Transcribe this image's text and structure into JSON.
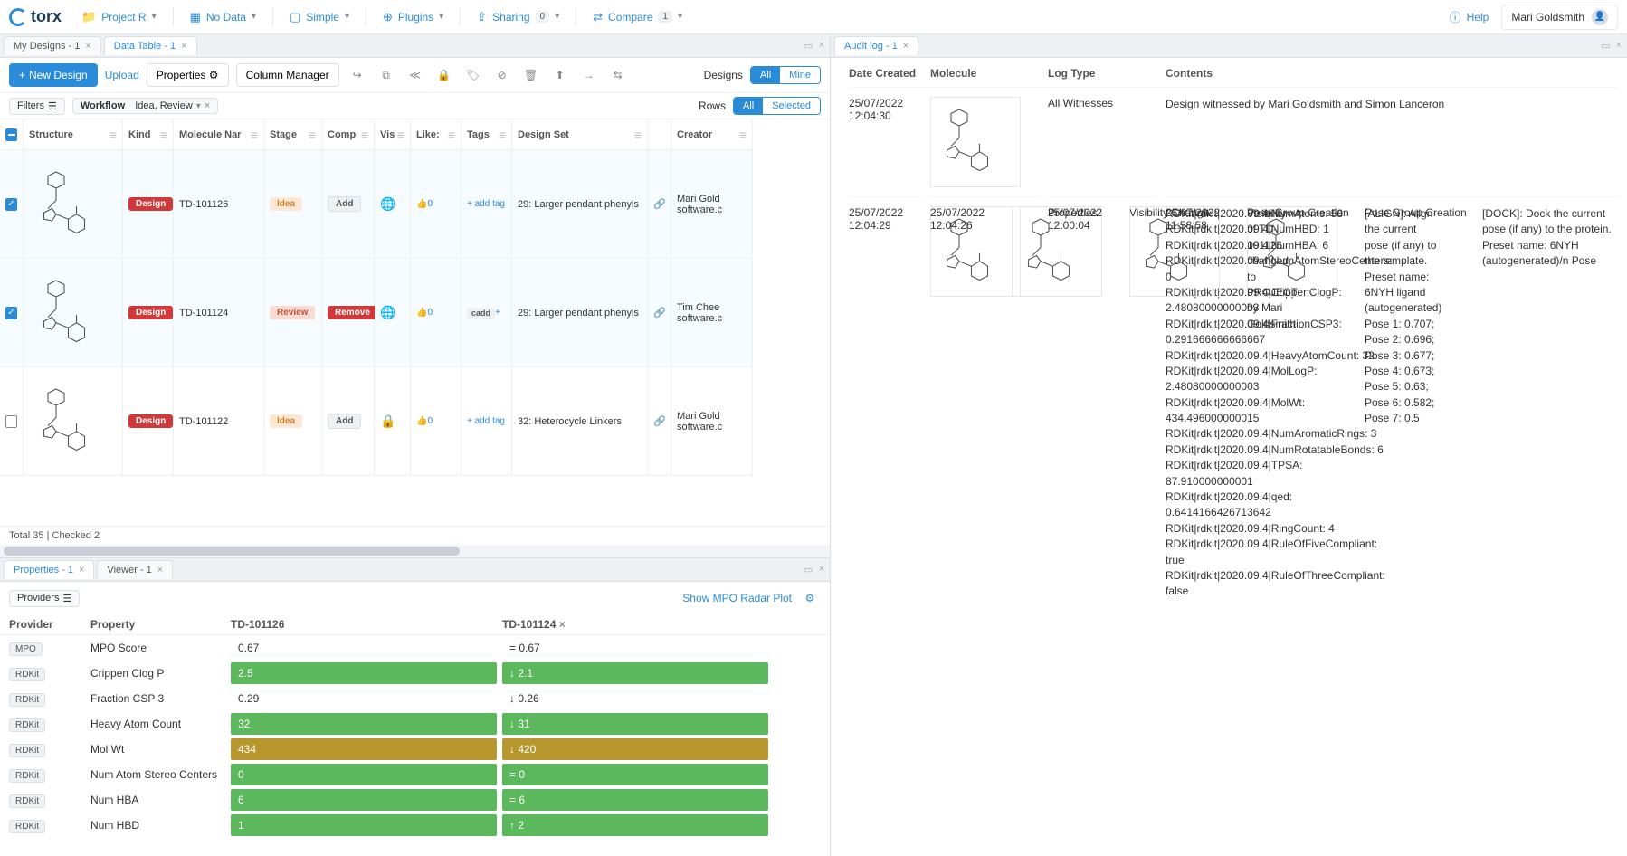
{
  "brand": "torx",
  "nav": {
    "project": "Project R",
    "nodata": "No Data",
    "simple": "Simple",
    "plugins": "Plugins",
    "sharing": "Sharing",
    "sharing_badge": "0",
    "compare": "Compare",
    "compare_badge": "1",
    "help": "Help",
    "user": "Mari Goldsmith"
  },
  "left_tabs": {
    "mydesigns": "My Designs - 1",
    "datatable": "Data Table - 1"
  },
  "toolbar": {
    "new_design": "New Design",
    "upload": "Upload",
    "properties": "Properties",
    "column_manager": "Column Manager",
    "designs_label": "Designs",
    "all": "All",
    "mine": "Mine"
  },
  "filters": {
    "filters_label": "Filters",
    "workflow_label": "Workflow",
    "workflow_value": "Idea, Review",
    "rows_label": "Rows",
    "rows_all": "All",
    "rows_selected": "Selected"
  },
  "table": {
    "headers": [
      "Structure",
      "Kind",
      "Molecule Nar",
      "Stage",
      "Comp",
      "Vis",
      "Like:",
      "Tags",
      "Design Set",
      "Creator"
    ],
    "rows": [
      {
        "checked": true,
        "kind": "Design",
        "name": "TD-101126",
        "stage": "Idea",
        "comp": "Add",
        "vis": "globe",
        "like": "0",
        "tags_add": "+ add tag",
        "tags": "",
        "set": "29: Larger pendant phenyls",
        "creator": "Mari Gold\nsoftware.c"
      },
      {
        "checked": true,
        "kind": "Design",
        "name": "TD-101124",
        "stage": "Review",
        "comp": "Remove",
        "vis": "globe",
        "like": "0",
        "tags_add": "",
        "tags": "cadd",
        "tags_plus": "+",
        "set": "29: Larger pendant phenyls",
        "creator": "Tim Chee\nsoftware.c"
      },
      {
        "checked": false,
        "kind": "Design",
        "name": "TD-101122",
        "stage": "Idea",
        "comp": "Add",
        "vis": "lock",
        "like": "0",
        "tags_add": "+ add tag",
        "tags": "",
        "set": "32: Heterocycle Linkers",
        "creator": "Mari Gold\nsoftware.c"
      }
    ],
    "footer": "Total 35 | Checked 2"
  },
  "bottom_tabs": {
    "properties": "Properties - 1",
    "viewer": "Viewer - 1"
  },
  "providers": {
    "label": "Providers",
    "show_radar": "Show MPO Radar Plot"
  },
  "props": {
    "head": [
      "Provider",
      "Property",
      "TD-101126",
      "TD-101124"
    ],
    "rows": [
      {
        "prov": "MPO",
        "prop": "MPO Score",
        "a": "0.67",
        "b": "= 0.67",
        "cls": "plain"
      },
      {
        "prov": "RDKit",
        "prop": "Crippen Clog P",
        "a": "2.5",
        "b": "↓ 2.1",
        "cls": "green"
      },
      {
        "prov": "RDKit",
        "prop": "Fraction CSP 3",
        "a": "0.29",
        "b": "↓ 0.26",
        "cls": "plain"
      },
      {
        "prov": "RDKit",
        "prop": "Heavy Atom Count",
        "a": "32",
        "b": "↓ 31",
        "cls": "green"
      },
      {
        "prov": "RDKit",
        "prop": "Mol Wt",
        "a": "434",
        "b": "↓ 420",
        "cls": "olive"
      },
      {
        "prov": "RDKit",
        "prop": "Num Atom Stereo Centers",
        "a": "0",
        "b": "= 0",
        "cls": "green"
      },
      {
        "prov": "RDKit",
        "prop": "Num HBA",
        "a": "6",
        "b": "= 6",
        "cls": "green"
      },
      {
        "prov": "RDKit",
        "prop": "Num HBD",
        "a": "1",
        "b": "↑ 2",
        "cls": "green"
      }
    ]
  },
  "right_tab": "Audit log - 1",
  "audit": {
    "head": [
      "Date Created",
      "Molecule",
      "Log Type",
      "Contents"
    ],
    "rows": [
      {
        "date": "25/07/2022\n12:04:30",
        "type": "All Witnesses",
        "content": "Design witnessed by Mari Goldsmith <mari@torx-software.com> and Simon Lanceron <simon@tor"
      },
      {
        "date": "25/07/2022\n12:04:29",
        "type": "Properties",
        "content": "RDKit|rdkit|2020.09.4|NumAtoms: 58\nRDKit|rdkit|2020.09.4|NumHBD: 1\nRDKit|rdkit|2020.09.4|NumHBA: 6\nRDKit|rdkit|2020.09.4|NumAtomStereoCenters: 0\nRDKit|rdkit|2020.09.4|CrippenClogP: 2.48080000000003\nRDKit|rdkit|2020.09.4|FractionCSP3: 0.291666666666667\nRDKit|rdkit|2020.09.4|HeavyAtomCount: 32\nRDKit|rdkit|2020.09.4|MolLogP: 2.48080000000003\nRDKit|rdkit|2020.09.4|MolWt: 434.496000000015\nRDKit|rdkit|2020.09.4|NumAromaticRings: 3\nRDKit|rdkit|2020.09.4|NumRotatableBonds: 6\nRDKit|rdkit|2020.09.4|TPSA: 87.910000000001\nRDKit|rdkit|2020.09.4|qed: 0.6414166426713642\nRDKit|rdkit|2020.09.4|RingCount: 4\nRDKit|rdkit|2020.09.4|RuleOfFiveCompliant: true\nRDKit|rdkit|2020.09.4|RuleOfThreeCompliant: false"
      },
      {
        "date": "25/07/2022\n12:04:26",
        "type": "Visibility Change",
        "content": "Visibility of TD-101126 changed to PROJECT by Mari Goldsmith <mari@torx-software.com>"
      },
      {
        "date": "25/07/2022\n12:00:04",
        "type": "Pose Group Creation",
        "content": "[ALIGN]: Align the current pose (if any) to the template.  Preset name: 6NYH ligand (autogenerated)\nPose 1: 0.707; Pose 2: 0.696; Pose 3: 0.677; Pose 4: 0.673; Pose 5: 0.63; Pose 6: 0.582; Pose 7: 0.5"
      },
      {
        "date": "25/07/2022\n11:58:58",
        "type": "Pose Group Creation",
        "content": "[DOCK]: Dock the current pose (if any) to the protein.  Preset name: 6NYH (autogenerated)/n Pose"
      }
    ]
  }
}
